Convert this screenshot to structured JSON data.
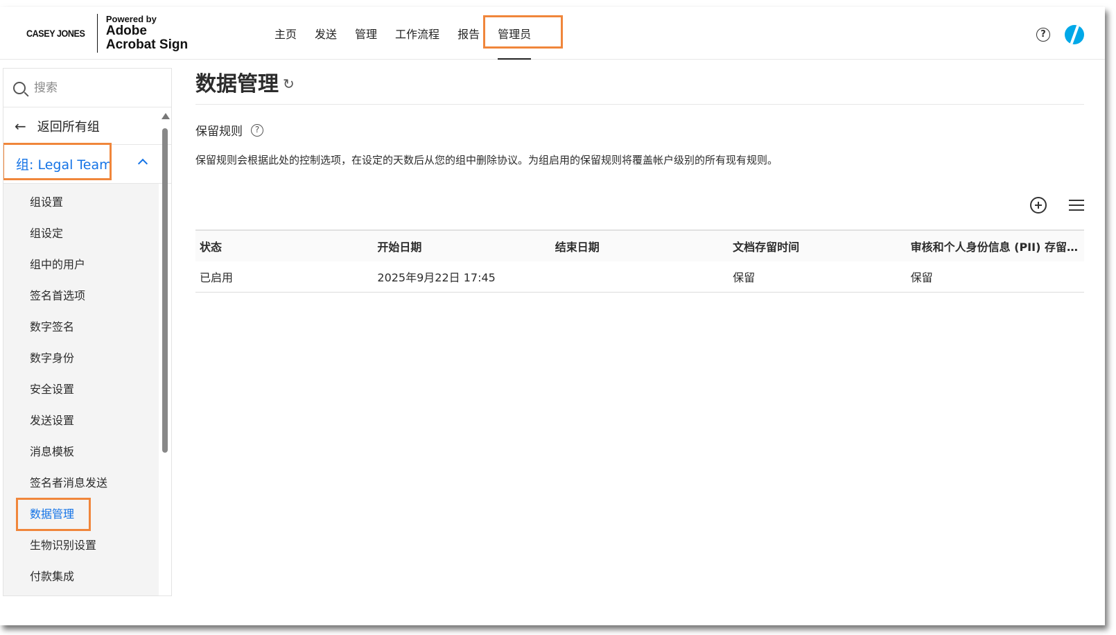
{
  "header": {
    "brand_casey": "CASEY JONES",
    "brand_powered_by": "Powered by",
    "brand_adobe": "Adobe",
    "brand_acrobat_sign": "Acrobat Sign",
    "nav": [
      "主页",
      "发送",
      "管理",
      "工作流程",
      "报告",
      "管理员"
    ],
    "help_glyph": "?"
  },
  "sidebar": {
    "search_placeholder": "搜索",
    "back_label": "返回所有组",
    "group_title": "组: Legal Team",
    "items": [
      "组设置",
      "组设定",
      "组中的用户",
      "签名首选项",
      "数字签名",
      "数字身份",
      "安全设置",
      "发送设置",
      "消息模板",
      "签名者消息发送",
      "数据管理",
      "生物识别设置",
      "付款集成"
    ],
    "active_item": "数据管理"
  },
  "main": {
    "page_title": "数据管理",
    "section_title": "保留规则",
    "description": "保留规则会根据此处的控制选项，在设定的天数后从您的组中删除协议。为组启用的保留规则将覆盖帐户级别的所有现有规则。",
    "table": {
      "columns": [
        "状态",
        "开始日期",
        "结束日期",
        "文档存留时间",
        "审核和个人身份信息 (PII) 存留时间"
      ],
      "rows": [
        [
          "已启用",
          "2025年9月22日 17:45",
          "",
          "保留",
          "保留"
        ]
      ]
    }
  },
  "colors": {
    "accent_blue": "#1473e6",
    "highlight_orange": "#f0863b",
    "avatar": "#00a8e8"
  },
  "icons": [
    "search-icon",
    "back-arrow-icon",
    "chevron-up-icon",
    "refresh-icon",
    "help-icon",
    "add-icon",
    "menu-icon",
    "avatar"
  ]
}
